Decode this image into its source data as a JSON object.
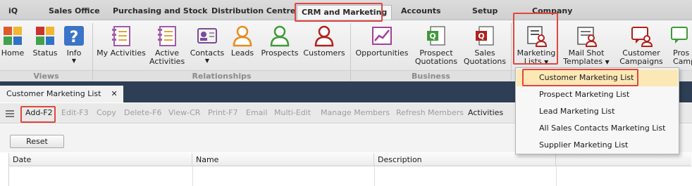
{
  "menu": {
    "tabs": [
      {
        "label": "iQ"
      },
      {
        "label": "Sales Office"
      },
      {
        "label": "Purchasing and Stock"
      },
      {
        "label": "Distribution Centre"
      },
      {
        "label": "CRM and Marketing"
      },
      {
        "label": "Accounts"
      },
      {
        "label": "Setup"
      },
      {
        "label": "Company"
      }
    ],
    "active_tab": "CRM and Marketing"
  },
  "ribbon": {
    "buttons": [
      {
        "label": "Home",
        "icon": "home-tiles-icon"
      },
      {
        "label": "Status",
        "icon": "status-tiles-icon"
      },
      {
        "label": "Info",
        "icon": "question-icon",
        "has_arrow": true
      },
      {
        "label": "My Activities",
        "icon": "notebook-icon"
      },
      {
        "label": "Active",
        "label2": "Activities",
        "icon": "notebook-icon"
      },
      {
        "label": "Contacts",
        "icon": "contact-card-icon",
        "has_arrow": true
      },
      {
        "label": "Leads",
        "icon": "person-orange-icon"
      },
      {
        "label": "Prospects",
        "icon": "person-green-icon"
      },
      {
        "label": "Customers",
        "icon": "person-red-icon"
      },
      {
        "label": "Opportunities",
        "icon": "chart-icon"
      },
      {
        "label": "Prospect",
        "label2": "Quotations",
        "icon": "quote-green-icon"
      },
      {
        "label": "Sales",
        "label2": "Quotations",
        "icon": "quote-red-icon"
      },
      {
        "label": "Marketing",
        "label2": "Lists",
        "icon": "marketing-list-icon",
        "has_arrow": true
      },
      {
        "label": "Mail Shot",
        "label2": "Templates",
        "icon": "mailshot-icon",
        "has_arrow": true
      },
      {
        "label": "Customer",
        "label2": "Campaigns",
        "icon": "campaign-red-icon"
      },
      {
        "label": "Pros",
        "label2": "Camp",
        "icon": "campaign-green-icon"
      }
    ],
    "groups": [
      {
        "label": "Views"
      },
      {
        "label": "Relationships"
      },
      {
        "label": "Business"
      }
    ],
    "arrow_glyph": "▼"
  },
  "doc_tab": {
    "label": "Customer Marketing List",
    "close": "✕"
  },
  "toolbar": {
    "items": [
      {
        "label": "Add-F2",
        "enabled": true
      },
      {
        "label": "Edit-F3",
        "enabled": false
      },
      {
        "label": "Copy",
        "enabled": false
      },
      {
        "label": "Delete-F6",
        "enabled": false
      },
      {
        "label": "View-CR",
        "enabled": false
      },
      {
        "label": "Print-F7",
        "enabled": false
      },
      {
        "label": "Email",
        "enabled": false
      },
      {
        "label": "Multi-Edit",
        "enabled": false
      },
      {
        "label": "Manage Members",
        "enabled": false
      },
      {
        "label": "Refresh Members",
        "enabled": false
      },
      {
        "label": "Activities",
        "enabled": true
      }
    ]
  },
  "filter": {
    "reset_label": "Reset"
  },
  "grid": {
    "columns": [
      {
        "label": "Date"
      },
      {
        "label": "Name"
      },
      {
        "label": "Description"
      }
    ]
  },
  "dropdown": {
    "items": [
      {
        "label": "Customer Marketing List",
        "selected": true
      },
      {
        "label": "Prospect Marketing List"
      },
      {
        "label": "Lead Marketing List"
      },
      {
        "label": "All Sales Contacts Marketing List"
      },
      {
        "label": "Supplier Marketing List"
      }
    ]
  },
  "colors": {
    "highlight": "#e2463f",
    "doc_bar": "#2d3e55",
    "selected_item": "#fbe8b5"
  }
}
